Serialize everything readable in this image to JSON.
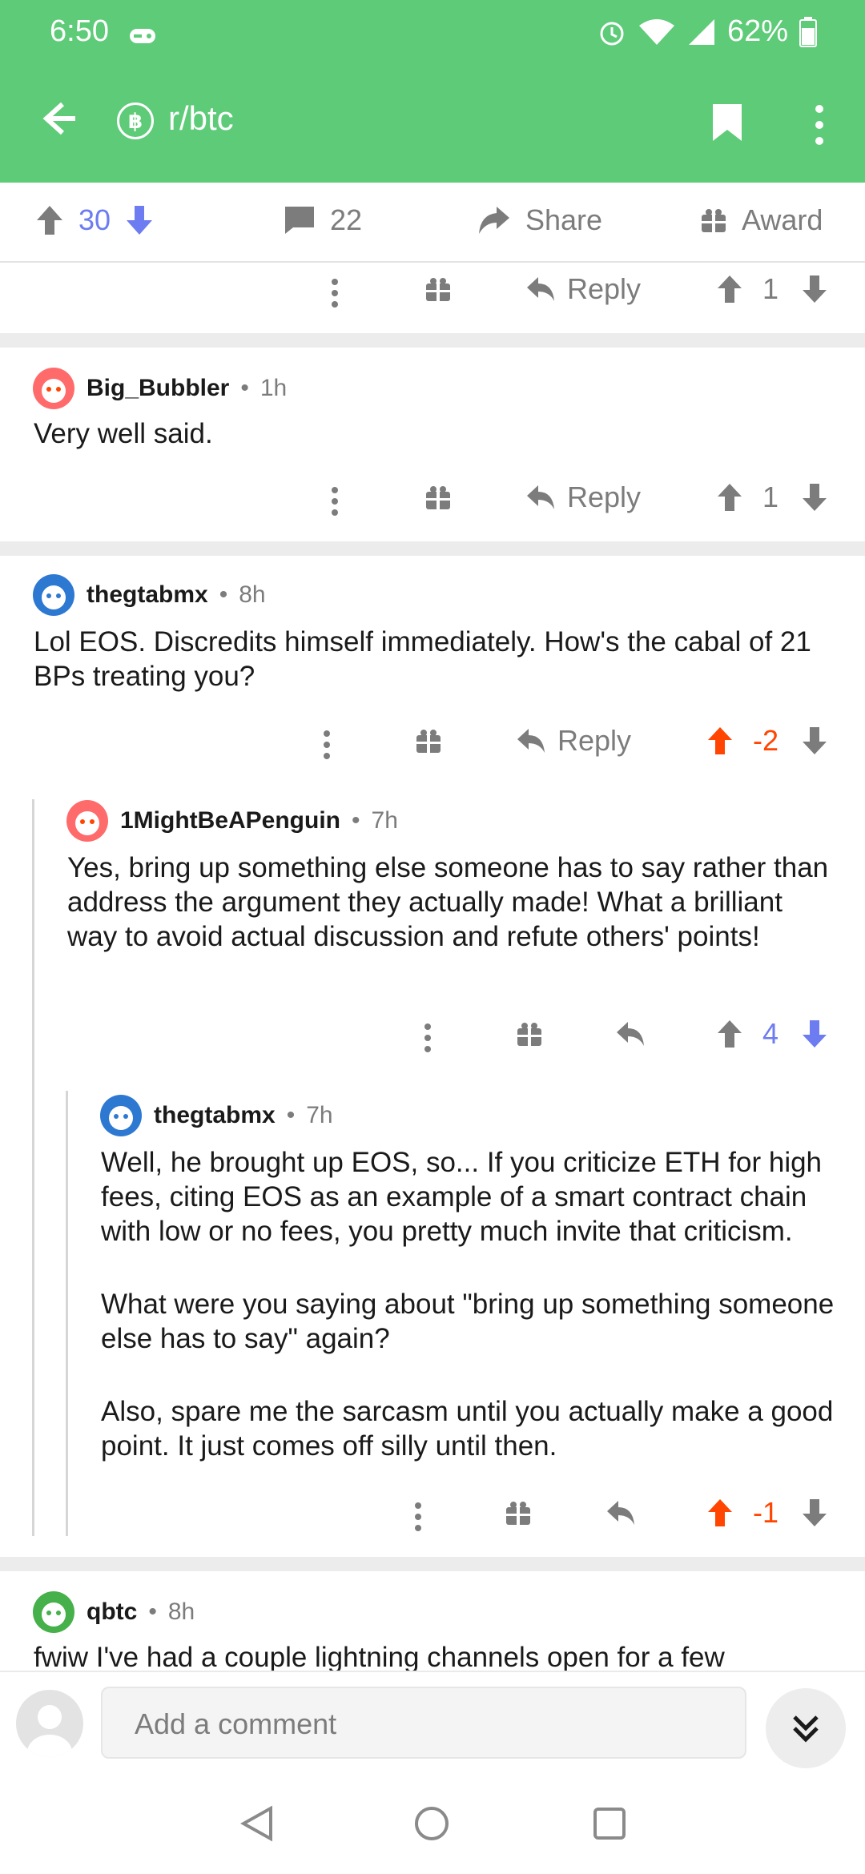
{
  "status": {
    "time": "6:50",
    "battery": "62%"
  },
  "toolbar": {
    "subreddit": "r/btc",
    "sub_icon": "bitcoin-icon"
  },
  "post_bar": {
    "score": "30",
    "comments": "22",
    "share": "Share",
    "award": "Award"
  },
  "top_actions": {
    "reply": "Reply",
    "score": "1"
  },
  "comments": [
    {
      "author": "Big_Bubbler",
      "time": "1h",
      "body": "Very well said.",
      "reply": "Reply",
      "score": "1"
    },
    {
      "author": "thegtabmx",
      "time": "8h",
      "body": "Lol EOS. Discredits himself immediately. How's the cabal of 21 BPs treating you?",
      "reply": "Reply",
      "score": "-2"
    },
    {
      "author": "1MightBeAPenguin",
      "time": "7h",
      "body": "Yes, bring up something else someone has to say rather than address the argument they actually made! What a brilliant way to avoid actual discussion and refute others' points!",
      "score": "4"
    },
    {
      "author": "thegtabmx",
      "time": "7h",
      "paragraphs": [
        "Well, he brought up EOS, so... If you criticize ETH for high fees, citing EOS as an example of a smart contract chain with low or no fees, you pretty much invite that criticism.",
        "What were you saying about \"bring up something someone else has to say\" again?",
        "Also, spare me the sarcasm until you actually make a good point. It just comes off silly until then."
      ],
      "score": "-1"
    },
    {
      "author": "qbtc",
      "time": "8h",
      "body": "fwiw I've had a couple lightning channels open for a few"
    }
  ],
  "composer": {
    "placeholder": "Add a comment"
  },
  "colors": {
    "header": "#5ecb78",
    "upvote": "#ff4500",
    "downvote": "#6d7cf0",
    "meta": "#7c7c7c"
  }
}
